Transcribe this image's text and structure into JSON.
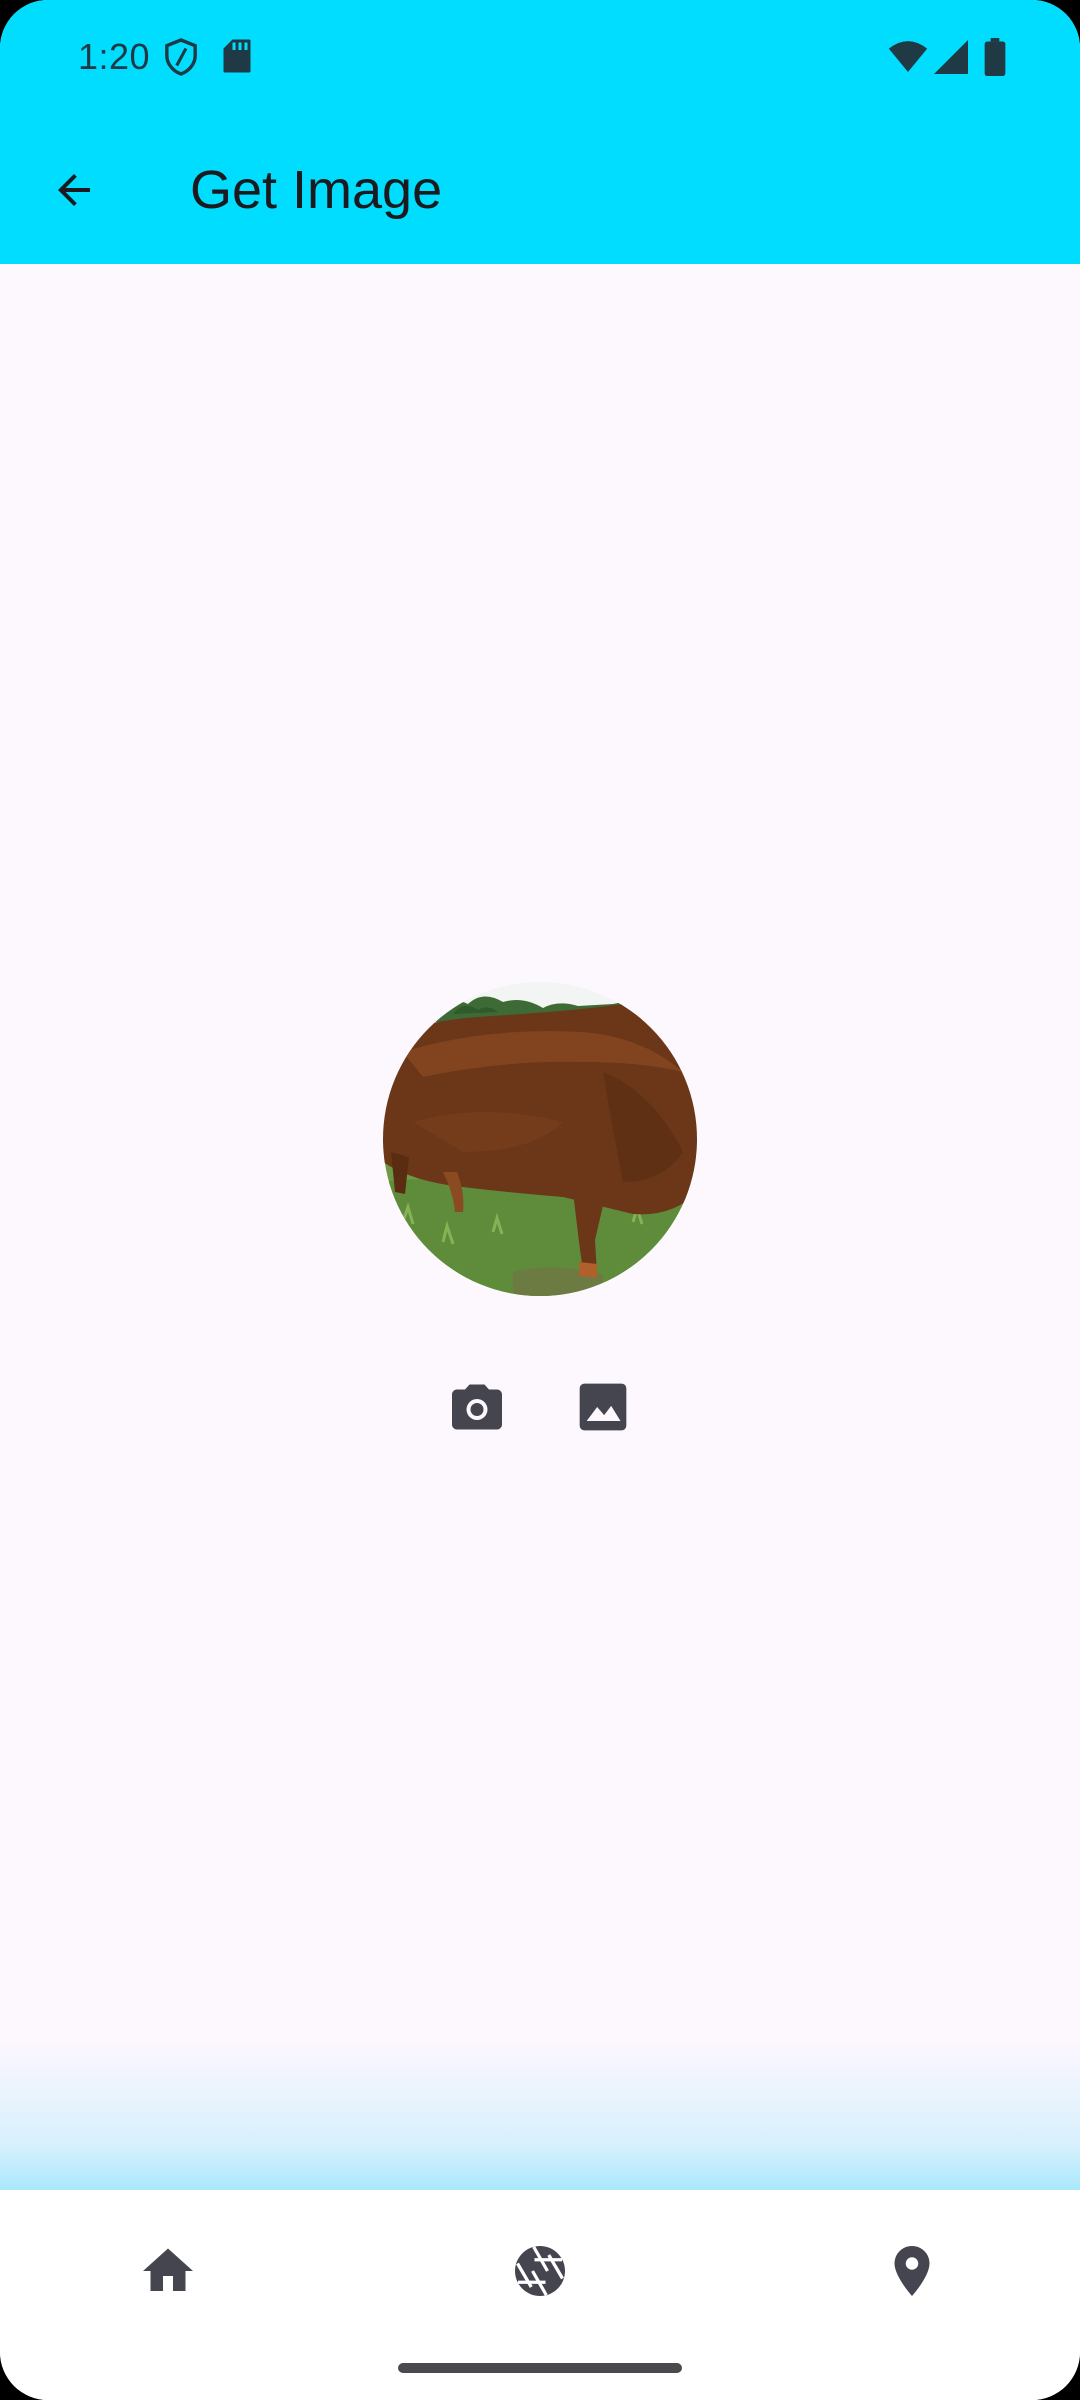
{
  "status_bar": {
    "time": "1:20",
    "icons": [
      "shield-icon",
      "sd-card-icon",
      "wifi-icon",
      "cellular-signal-icon",
      "battery-icon"
    ]
  },
  "toolbar": {
    "back_icon": "arrow-back-icon",
    "title": "Get Image",
    "background_color": "#00DDFF"
  },
  "main": {
    "image_preview": "avatar-image",
    "actions": [
      {
        "name": "camera",
        "icon": "camera-icon"
      },
      {
        "name": "gallery",
        "icon": "image-icon"
      }
    ]
  },
  "bottom_nav": {
    "items": [
      {
        "name": "home",
        "icon": "home-icon"
      },
      {
        "name": "camera",
        "icon": "camera-aperture-icon"
      },
      {
        "name": "location",
        "icon": "location-pin-icon"
      }
    ]
  },
  "colors": {
    "app_bar": "#00DDFF",
    "background": "#FDF7FE",
    "icon": "#45454f"
  }
}
